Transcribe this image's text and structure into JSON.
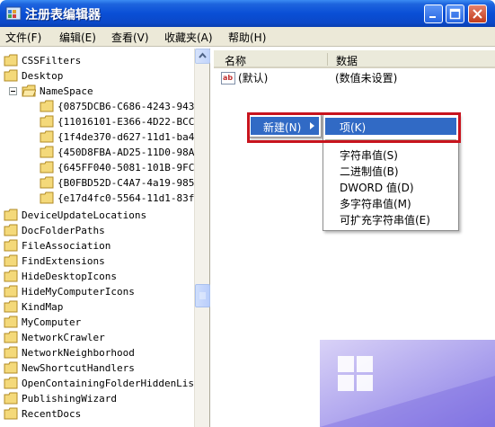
{
  "window": {
    "title": "注册表编辑器",
    "controls": {
      "minimize": "minimize",
      "maximize": "maximize",
      "close": "close"
    }
  },
  "menubar": {
    "items": [
      {
        "label": "文件(F)"
      },
      {
        "label": "编辑(E)"
      },
      {
        "label": "查看(V)"
      },
      {
        "label": "收藏夹(A)"
      },
      {
        "label": "帮助(H)"
      }
    ]
  },
  "tree": {
    "items": [
      {
        "label": "CSSFilters"
      },
      {
        "label": "Desktop"
      },
      {
        "label": "NameSpace"
      },
      {
        "label": "{0875DCB6-C686-4243-943"
      },
      {
        "label": "{11016101-E366-4D22-BCC"
      },
      {
        "label": "{1f4de370-d627-11d1-ba4"
      },
      {
        "label": "{450D8FBA-AD25-11D0-98A"
      },
      {
        "label": "{645FF040-5081-101B-9FC"
      },
      {
        "label": "{B0FBD52D-C4A7-4a19-985"
      },
      {
        "label": "{e17d4fc0-5564-11d1-83f"
      },
      {
        "label": "DeviceUpdateLocations"
      },
      {
        "label": "DocFolderPaths"
      },
      {
        "label": "FileAssociation"
      },
      {
        "label": "FindExtensions"
      },
      {
        "label": "HideDesktopIcons"
      },
      {
        "label": "HideMyComputerIcons"
      },
      {
        "label": "KindMap"
      },
      {
        "label": "MyComputer"
      },
      {
        "label": "NetworkCrawler"
      },
      {
        "label": "NetworkNeighborhood"
      },
      {
        "label": "NewShortcutHandlers"
      },
      {
        "label": "OpenContainingFolderHiddenLis"
      },
      {
        "label": "PublishingWizard"
      },
      {
        "label": "RecentDocs"
      }
    ]
  },
  "list": {
    "columns": {
      "name": "名称",
      "data": "数据"
    },
    "rows": [
      {
        "name": "(默认)",
        "data": "(数值未设置)"
      }
    ]
  },
  "context_menu": {
    "parent_label": "新建(N)",
    "submenu": [
      {
        "label": "项(K)"
      },
      {
        "label": "字符串值(S)"
      },
      {
        "label": "二进制值(B)"
      },
      {
        "label": "DWORD 值(D)"
      },
      {
        "label": "多字符串值(M)"
      },
      {
        "label": "可扩充字符串值(E)"
      }
    ]
  },
  "colors": {
    "highlight": "#316ac5",
    "annotation_frame": "#c8141e",
    "titlebar": "#0a4fd6"
  }
}
